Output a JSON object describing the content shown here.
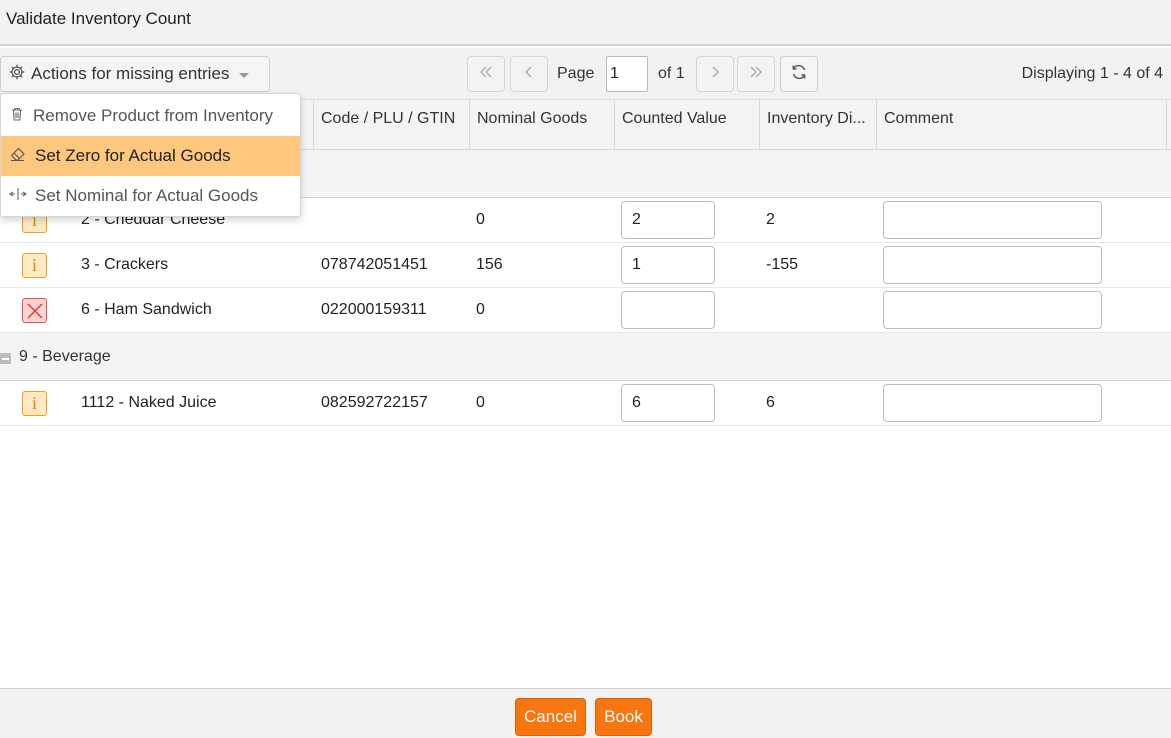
{
  "window": {
    "title": "Validate Inventory Count"
  },
  "toolbar": {
    "actions_label": "Actions for missing entries",
    "page_label": "Page",
    "page_value": "1",
    "of_label": "of 1",
    "displaying": "Displaying 1 - 4 of 4"
  },
  "actions_menu": {
    "items": [
      {
        "label": "Remove Product from Inventory",
        "icon": "trash-icon",
        "highlighted": false
      },
      {
        "label": "Set Zero for Actual Goods",
        "icon": "eraser-icon",
        "highlighted": true
      },
      {
        "label": "Set Nominal for Actual Goods",
        "icon": "split-arrows-icon",
        "highlighted": false
      }
    ]
  },
  "grid": {
    "columns": [
      "",
      "",
      "Code / PLU / GTIN",
      "Nominal Goods",
      "Counted Value",
      "Inventory Di...",
      "Comment"
    ],
    "groups": [
      {
        "label": "",
        "rows": [
          {
            "status": "info",
            "product": "2 - Cheddar Cheese",
            "code": "",
            "nominal": "0",
            "counted": "2",
            "difference": "2",
            "comment": ""
          },
          {
            "status": "info",
            "product": "3 - Crackers",
            "code": "078742051451",
            "nominal": "156",
            "counted": "1",
            "difference": "-155",
            "comment": ""
          },
          {
            "status": "missing",
            "product": "6 - Ham Sandwich",
            "code": "022000159311",
            "nominal": "0",
            "counted": "",
            "difference": "",
            "comment": ""
          }
        ]
      },
      {
        "label": "9 - Beverage",
        "rows": [
          {
            "status": "info",
            "product": "1112 - Naked Juice",
            "code": "082592722157",
            "nominal": "0",
            "counted": "6",
            "difference": "6",
            "comment": ""
          }
        ]
      }
    ]
  },
  "footer": {
    "cancel_label": "Cancel",
    "book_label": "Book"
  },
  "colors": {
    "accent": "#f7760f",
    "highlight": "#fdc87d",
    "info": "#f0a020",
    "error": "#dd5555"
  }
}
